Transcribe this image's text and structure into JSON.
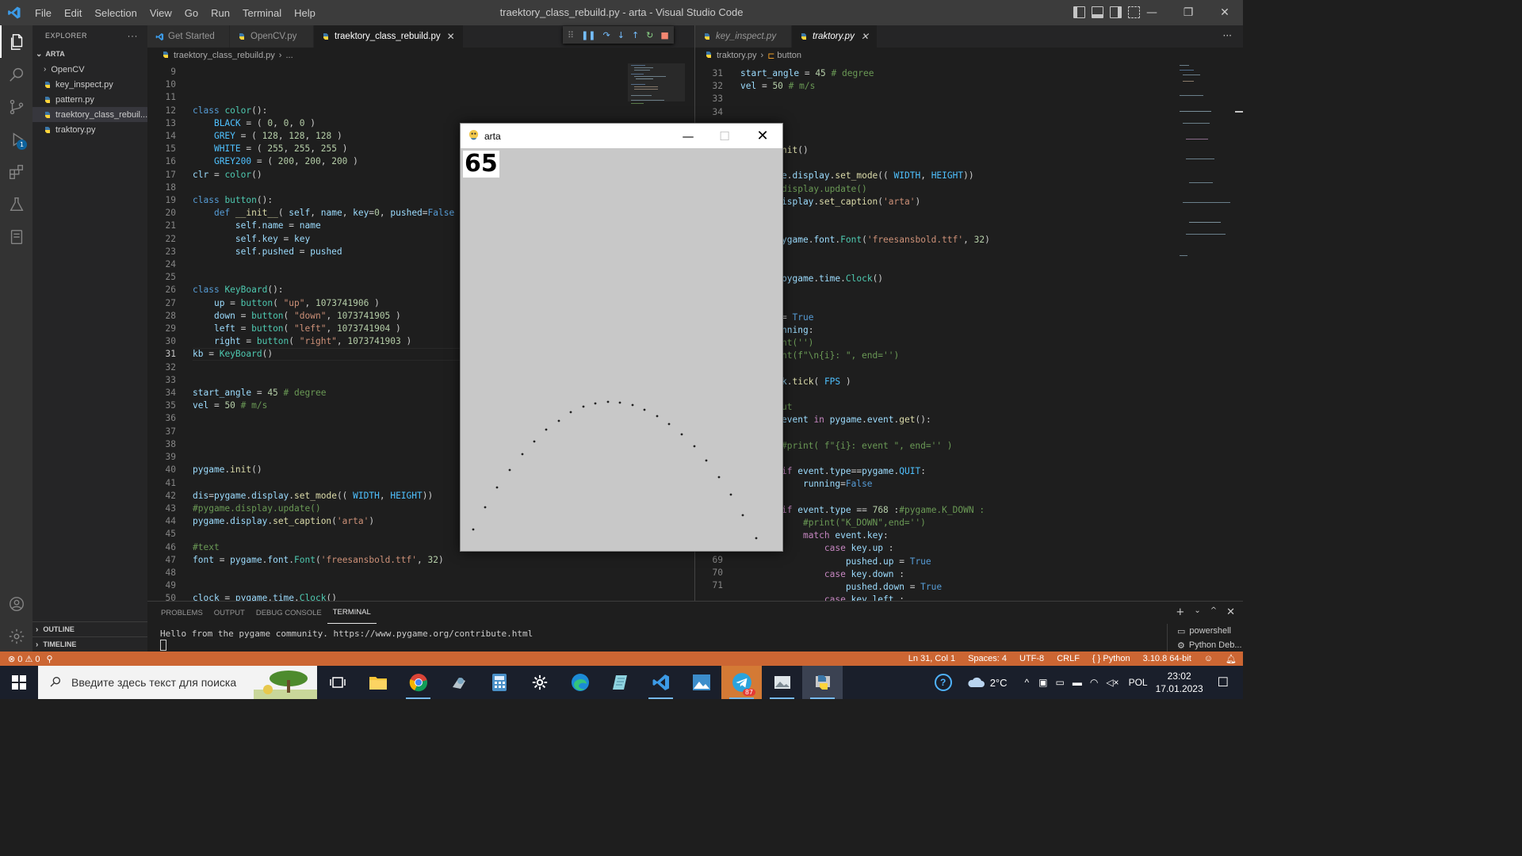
{
  "window": {
    "title": "traektory_class_rebuild.py - arta - Visual Studio Code",
    "menu": [
      "File",
      "Edit",
      "Selection",
      "View",
      "Go",
      "Run",
      "Terminal",
      "Help"
    ]
  },
  "sidebar": {
    "header": "EXPLORER",
    "more": "···",
    "folder": "ARTA",
    "items": [
      {
        "label": "OpenCV",
        "type": "folder"
      },
      {
        "label": "key_inspect.py",
        "type": "file"
      },
      {
        "label": "pattern.py",
        "type": "file"
      },
      {
        "label": "traektory_class_rebuil...",
        "type": "file",
        "active": true
      },
      {
        "label": "traktory.py",
        "type": "file"
      }
    ],
    "outline": "OUTLINE",
    "timeline": "TIMELINE"
  },
  "activity": {
    "run_badge": "1"
  },
  "editor_left": {
    "tabs": [
      {
        "label": "Get Started",
        "icon": "vscode-icon"
      },
      {
        "label": "OpenCV.py",
        "icon": "python-icon"
      },
      {
        "label": "traektory_class_rebuild.py",
        "icon": "python-icon",
        "active": true,
        "close": "✕"
      }
    ],
    "breadcrumb": [
      "traektory_class_rebuild.py",
      "..."
    ],
    "line_numbers": [
      "9",
      "10",
      "11",
      "12",
      "13",
      "14",
      "15",
      "16",
      "17",
      "18",
      "19",
      "20",
      "21",
      "22",
      "23",
      "24",
      "25",
      "26",
      "27",
      "28",
      "29",
      "30",
      "31",
      "32",
      "33",
      "34",
      "35",
      "36",
      "37",
      "38",
      "39",
      "40",
      "41",
      "42",
      "43",
      "44",
      "45",
      "46",
      "47",
      "48",
      "49",
      "50"
    ],
    "current_line": "31"
  },
  "editor_right": {
    "tabs": [
      {
        "label": "key_inspect.py",
        "icon": "python-icon"
      },
      {
        "label": "traktory.py",
        "icon": "python-icon",
        "active": true,
        "close": "✕"
      }
    ],
    "breadcrumb": [
      "traktory.py",
      "button"
    ],
    "line_numbers_top": [
      "31",
      "32",
      "33",
      "34"
    ],
    "line_numbers_bottom": [
      "69",
      "70",
      "71"
    ]
  },
  "panel": {
    "tabs": [
      "PROBLEMS",
      "OUTPUT",
      "DEBUG CONSOLE",
      "TERMINAL"
    ],
    "active_tab": "TERMINAL",
    "terminal_output": "Hello from the pygame community. https://www.pygame.org/contribute.html",
    "terminals": [
      "powershell",
      "Python Deb..."
    ]
  },
  "statusbar": {
    "errors": "0",
    "warnings": "0",
    "position": "Ln 31, Col 1",
    "spaces": "Spaces: 4",
    "encoding": "UTF-8",
    "eol": "CRLF",
    "language": "Python",
    "interpreter": "3.10.8 64-bit",
    "color": "#cc6633"
  },
  "pygame_window": {
    "title": "arta",
    "counter": "65",
    "background": "#c8c8c8"
  },
  "taskbar": {
    "search_placeholder": "Введите здесь текст для поиска",
    "temperature": "2°C",
    "language": "POL",
    "time": "23:02",
    "date": "17.01.2023",
    "telegram_badge": "87"
  }
}
